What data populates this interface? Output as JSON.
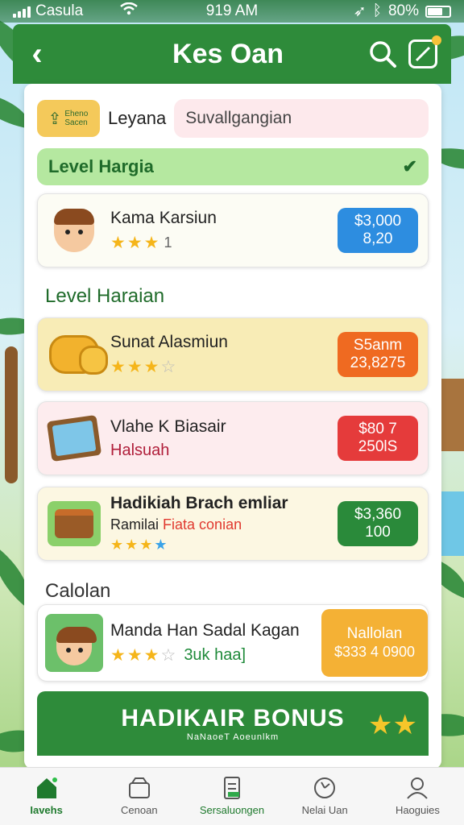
{
  "status_bar": {
    "carrier": "Casula",
    "time": "919 AM",
    "battery": "80%"
  },
  "header": {
    "title": "Kes Oan",
    "back_icon": "chevron-left-icon",
    "search_icon": "search-icon",
    "edit_icon": "edit-icon"
  },
  "service": {
    "badge_text": "Eheno Sacen",
    "label": "Leyana",
    "value": "Suvallgangian"
  },
  "level_banner": {
    "label": "Level Hargia"
  },
  "sections": {
    "harian": "Level Haraian",
    "calolan": "Calolan"
  },
  "items": [
    {
      "name": "Kama Karsiun",
      "stars": 3,
      "tail": "1",
      "price_line1": "$3,000",
      "price_line2": "8,20",
      "price_color": "#2d8de0",
      "icon": "man-avatar-icon"
    },
    {
      "name": "Sunat Alasmiun",
      "stars": 3,
      "max_stars": 4,
      "price_line1": "S5anm",
      "price_line2": "23,8275",
      "price_color": "#ef6a21",
      "icon": "coins-icon"
    },
    {
      "name": "Vlahe K Biasair",
      "sub": "Halsuah",
      "price_line1": "$80 7",
      "price_line2": "250lS",
      "price_color": "#e53b3b",
      "icon": "picture-frame-icon"
    },
    {
      "name": "Hadikiah Brach emliar",
      "sub_label": "Ramilai",
      "sub_highlight": "Fiata conian",
      "stars": 3,
      "price_line1": "$3,360",
      "price_line2": "100",
      "price_color": "#2a8a3a",
      "icon": "treasure-chest-icon"
    },
    {
      "name": "Manda Han Sadal Kagan",
      "stars": 3,
      "max_stars": 4,
      "extra": "3uk haa]",
      "price_line1": "Nallolan",
      "price_line2": "$333 4 0900",
      "price_color": "#f4b135",
      "icon": "boy-portrait-icon"
    }
  ],
  "bonus": {
    "title": "HADIKAIR BONUS",
    "subtitle": "NaNaoeT Aoeunlkm"
  },
  "tabs": [
    {
      "label": "Iavehs",
      "icon": "home-icon",
      "active": true
    },
    {
      "label": "Cenoan",
      "icon": "store-icon",
      "active": false
    },
    {
      "label": "Sersaluongen",
      "icon": "document-icon",
      "active": false
    },
    {
      "label": "Nelai Uan",
      "icon": "clock-icon",
      "active": false
    },
    {
      "label": "Haoguies",
      "icon": "profile-icon",
      "active": false
    }
  ]
}
